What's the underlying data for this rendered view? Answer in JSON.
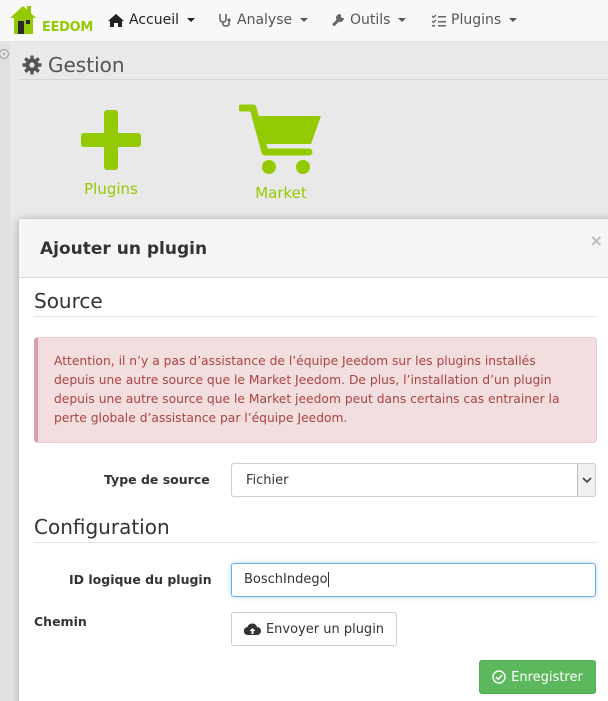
{
  "navbar": {
    "logo_text": "EEDOM",
    "items": [
      {
        "label": "Accueil",
        "icon": "home-icon"
      },
      {
        "label": "Analyse",
        "icon": "stethoscope-icon"
      },
      {
        "label": "Outils",
        "icon": "wrench-icon"
      },
      {
        "label": "Plugins",
        "icon": "tasks-icon"
      }
    ]
  },
  "page": {
    "title": "Gestion",
    "tiles": [
      {
        "label": "Plugins",
        "icon": "plus-icon"
      },
      {
        "label": "Market",
        "icon": "shopping-cart-icon"
      }
    ]
  },
  "modal": {
    "title": "Ajouter un plugin",
    "close": "×",
    "source_section": {
      "title": "Source",
      "alert": "Attention, il n’y a pas d’assistance de l’équipe Jeedom sur les plugins installés depuis une autre source que le Market Jeedom. De plus, l’installation d’un plugin depuis une autre source que le Market jeedom peut dans certains cas entrainer la perte globale d’assistance par l’équipe Jeedom.",
      "type_label": "Type de source",
      "type_value": "Fichier"
    },
    "config_section": {
      "title": "Configuration",
      "id_label": "ID logique du plugin",
      "id_value": "BoschIndego",
      "path_label": "Chemin",
      "upload_button": "Envoyer un plugin"
    },
    "save_button": "Enregistrer"
  },
  "colors": {
    "brand_green": "#94ca02",
    "success": "#5cb85c",
    "alert_text": "#a94442",
    "alert_bg": "#f2dede"
  }
}
